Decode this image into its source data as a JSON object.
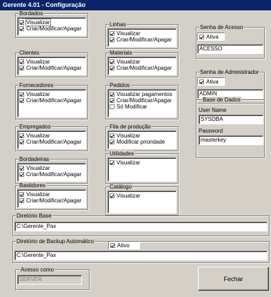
{
  "window": {
    "title": "Gerente 4.01 - Configuração"
  },
  "groups": {
    "bordados": {
      "title": "Bordados",
      "items": [
        {
          "label": "Visualizar",
          "checked": true
        },
        {
          "label": "Criar/Modificar/Apagar",
          "checked": true
        }
      ]
    },
    "clientes": {
      "title": "Clientes",
      "items": [
        {
          "label": "Visualizar",
          "checked": true
        },
        {
          "label": "Criar/Modificar/Apagar",
          "checked": true
        }
      ]
    },
    "fornecedores": {
      "title": "Fornecedores",
      "items": [
        {
          "label": "Visualizar",
          "checked": true
        },
        {
          "label": "Criar/Modificar/Apagar",
          "checked": true
        }
      ]
    },
    "empregados": {
      "title": "Empregados",
      "items": [
        {
          "label": "Visualizar",
          "checked": true
        },
        {
          "label": "Criar/Modificar/Apagar",
          "checked": true
        }
      ]
    },
    "bordadeiras": {
      "title": "Bordadeiras",
      "items": [
        {
          "label": "Visualizar",
          "checked": true
        },
        {
          "label": "Criar/Modificar/Apagar",
          "checked": true
        }
      ]
    },
    "bastidores": {
      "title": "Bastidores",
      "items": [
        {
          "label": "Visualizar",
          "checked": true
        },
        {
          "label": "Criar/Modificar/Apagar",
          "checked": true
        }
      ]
    },
    "linhas": {
      "title": "Linhas",
      "items": [
        {
          "label": "Visualizar",
          "checked": true
        },
        {
          "label": "Criar/Modificar/Apagar",
          "checked": true
        }
      ]
    },
    "materiais": {
      "title": "Materiais",
      "items": [
        {
          "label": "Visualizar",
          "checked": true
        },
        {
          "label": "Criar/Modificar/Apagar",
          "checked": true
        }
      ]
    },
    "pedidos": {
      "title": "Pedidos",
      "items": [
        {
          "label": "Visualizar pagamentos",
          "checked": true
        },
        {
          "label": "Criar/Modificar/Apagar",
          "checked": true
        },
        {
          "label": "Só Modificar",
          "checked": false
        }
      ]
    },
    "fila": {
      "title": "Fila de produção",
      "items": [
        {
          "label": "Visualizar",
          "checked": true
        },
        {
          "label": "Modificar prioridade",
          "checked": true
        }
      ]
    },
    "utilidades": {
      "title": "Utilidades",
      "items": [
        {
          "label": "Visualizar",
          "checked": true
        }
      ]
    },
    "catalogo": {
      "title": "Catálogo",
      "items": [
        {
          "label": "Visualizar",
          "checked": true
        }
      ]
    }
  },
  "senha_acesso": {
    "title": "Senha de Acesso",
    "ativa_label": "Ativa",
    "ativa_checked": true,
    "value": "ACESSO"
  },
  "senha_admin": {
    "title": "Senha de Administrador",
    "ativa_label": "Ativa",
    "ativa_checked": true,
    "value": "ADMIN"
  },
  "base_dados": {
    "title": "Base de Dados",
    "user_label": "User Name",
    "user_value": "SYSDBA",
    "password_label": "Password",
    "password_value": "masterkey"
  },
  "diretorio_base": {
    "title": "Diretório Base",
    "value": "C:\\Gerente_Pax"
  },
  "diretorio_backup": {
    "title": "Diretório de Backup Automático",
    "ativo_label": "Ativo",
    "ativo_checked": true,
    "value": "C:\\Gerente_Pax"
  },
  "acesso_como": {
    "title": "Acesso como",
    "value": "SERVER"
  },
  "fechar": {
    "label": "Fechar"
  }
}
